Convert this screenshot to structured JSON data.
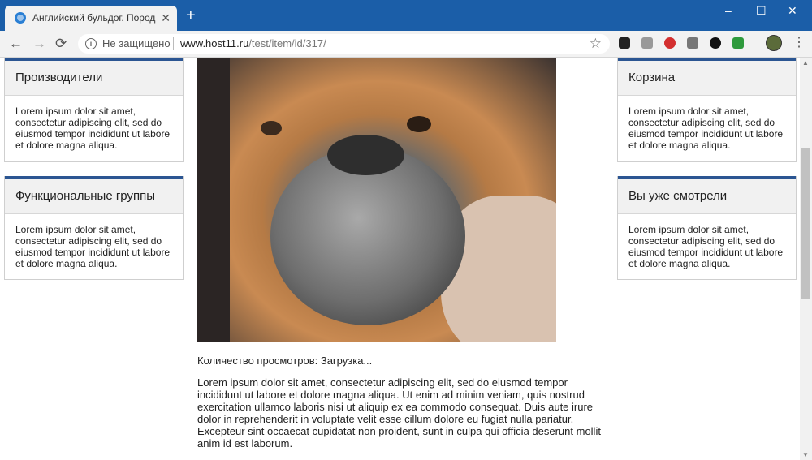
{
  "browser": {
    "tab_title": "Английский бульдог. Породы со",
    "new_tab": "+",
    "close_tab": "✕",
    "window_controls": {
      "minimize": "–",
      "maximize": "☐",
      "close": "✕"
    }
  },
  "toolbar": {
    "back": "←",
    "forward": "→",
    "reload": "⟳",
    "security_label": "Не защищено",
    "url_host": "www.host11.ru",
    "url_path": "/test/item/id/317/",
    "bookmark": "☆",
    "menu": "⋮",
    "extensions": [
      "incognito-ext-icon",
      "reader-ext-icon",
      "adblock-ext-icon",
      "monitor-ext-icon",
      "eye-ext-icon",
      "layers-ext-icon"
    ]
  },
  "left_sidebar": {
    "widgets": [
      {
        "title": "Производители",
        "text": "Lorem ipsum dolor sit amet, consectetur adipiscing elit, sed do eiusmod tempor incididunt ut labore et dolore magna aliqua."
      },
      {
        "title": "Функциональные группы",
        "text": "Lorem ipsum dolor sit amet, consectetur adipiscing elit, sed do eiusmod tempor incididunt ut labore et dolore magna aliqua."
      }
    ]
  },
  "right_sidebar": {
    "widgets": [
      {
        "title": "Корзина",
        "text": "Lorem ipsum dolor sit amet, consectetur adipiscing elit, sed do eiusmod tempor incididunt ut labore et dolore magna aliqua."
      },
      {
        "title": "Вы уже смотрели",
        "text": "Lorem ipsum dolor sit amet, consectetur adipiscing elit, sed do eiusmod tempor incididunt ut labore et dolore magna aliqua."
      }
    ]
  },
  "main": {
    "views_label": "Количество просмотров: Загрузка...",
    "description": "Lorem ipsum dolor sit amet, consectetur adipiscing elit, sed do eiusmod tempor incididunt ut labore et dolore magna aliqua. Ut enim ad minim veniam, quis nostrud exercitation ullamco laboris nisi ut aliquip ex ea commodo consequat. Duis aute irure dolor in reprehenderit in voluptate velit esse cillum dolore eu fugiat nulla pariatur. Excepteur sint occaecat cupidatat non proident, sunt in culpa qui officia deserunt mollit anim id est laborum."
  },
  "colors": {
    "titlebar": "#1b5ea8",
    "widget_accent": "#2b5592"
  }
}
